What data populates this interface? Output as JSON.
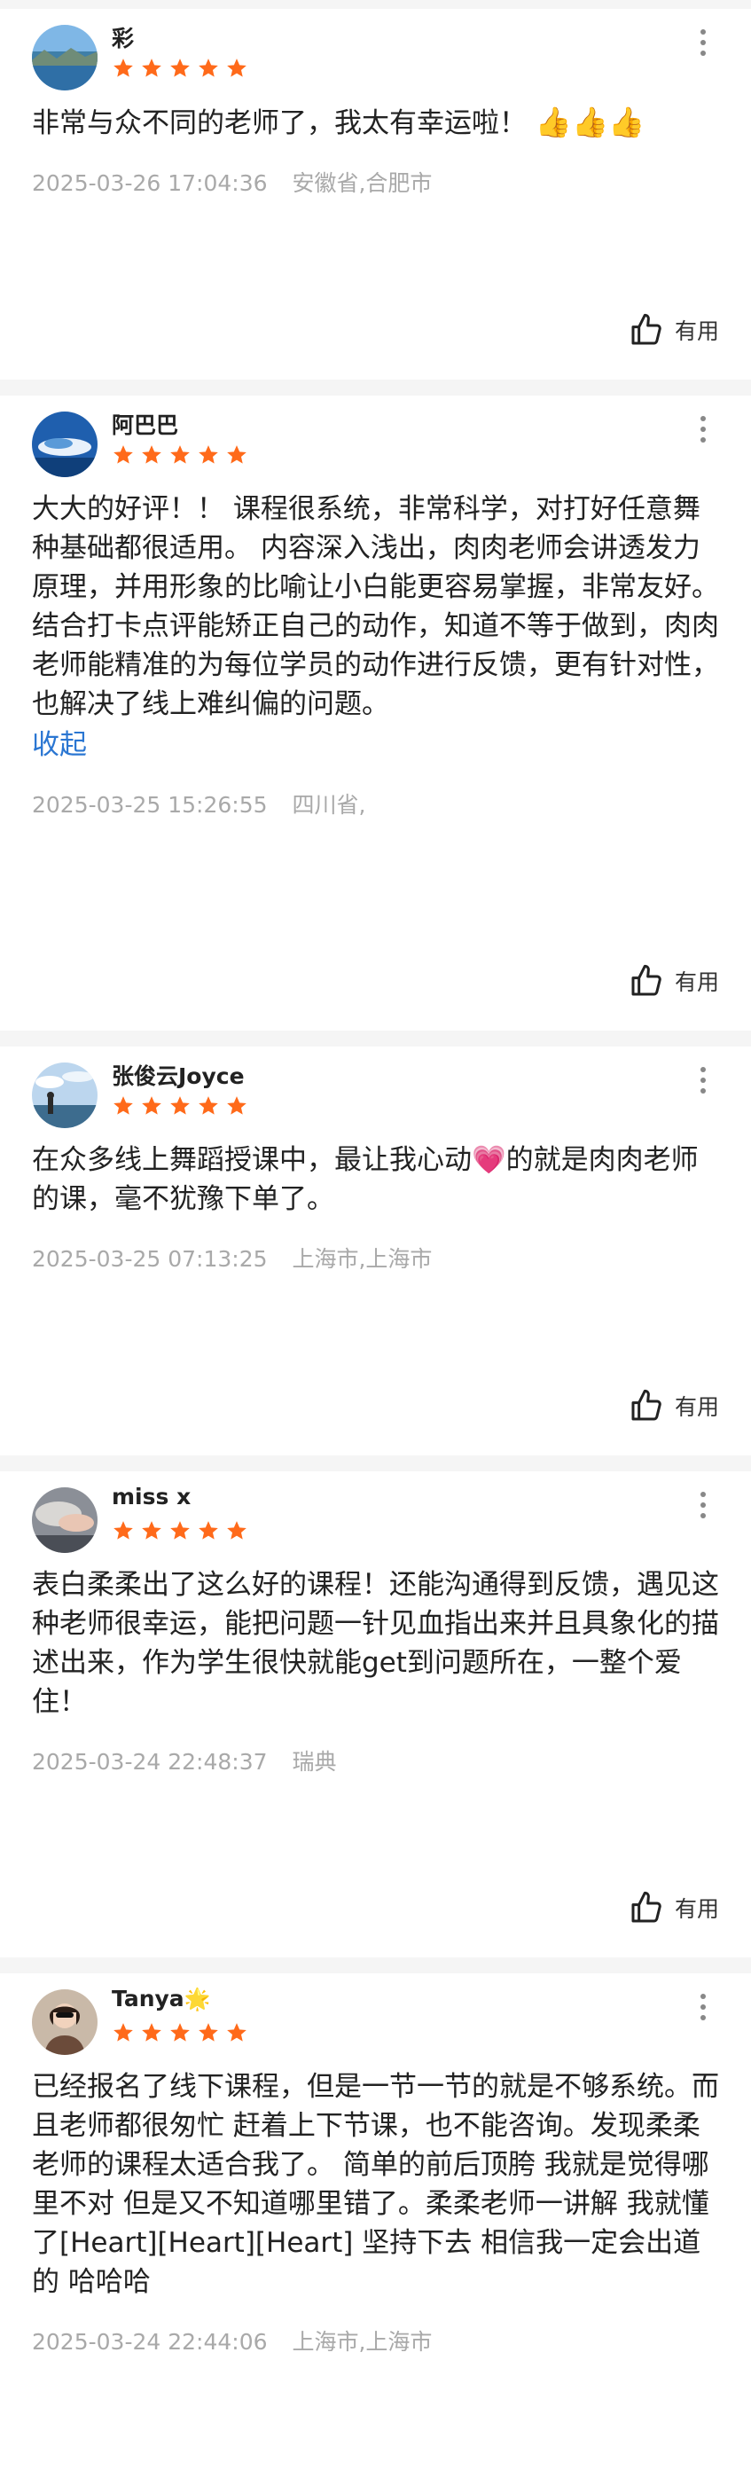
{
  "reviews": [
    {
      "name": "彩",
      "name_suffix": "",
      "rating": 5,
      "text": "非常与众不同的老师了，我太有幸运啦！",
      "text_emoji": "👍👍👍",
      "collapse": "",
      "date": "2025-03-26 17:04:36",
      "location": "安徽省,合肥市",
      "useful_label": "有用",
      "avatar": "avatar-lake-icon"
    },
    {
      "name": "阿巴巴",
      "name_suffix": "",
      "rating": 5,
      "text": "大大的好评！！ 课程很系统，非常科学，对打好任意舞种基础都很适用。 内容深入浅出，肉肉老师会讲透发力原理，并用形象的比喻让小白能更容易掌握，非常友好。 结合打卡点评能矫正自己的动作，知道不等于做到，肉肉老师能精准的为每位学员的动作进行反馈，更有针对性，也解决了线上难纠偏的问题。",
      "text_emoji": "",
      "collapse": "收起",
      "date": "2025-03-25 15:26:55",
      "location": "四川省,",
      "useful_label": "有用",
      "avatar": "avatar-wave-icon"
    },
    {
      "name": "张俊云Joyce",
      "name_suffix": "",
      "rating": 5,
      "text": "在众多线上舞蹈授课中，最让我心动💗的就是肉肉老师的课，毫不犹豫下单了。",
      "text_emoji": "",
      "collapse": "",
      "date": "2025-03-25 07:13:25",
      "location": "上海市,上海市",
      "useful_label": "有用",
      "avatar": "avatar-sky-icon"
    },
    {
      "name": "miss x",
      "name_suffix": "",
      "rating": 5,
      "text": "表白柔柔出了这么好的课程！还能沟通得到反馈，遇见这种老师很幸运，能把问题一针见血指出来并且具象化的描述出来，作为学生很快就能get到问题所在，一整个爱住！",
      "text_emoji": "",
      "collapse": "",
      "date": "2025-03-24 22:48:37",
      "location": "瑞典",
      "useful_label": "有用",
      "avatar": "avatar-cloud-icon"
    },
    {
      "name": "Tanya",
      "name_suffix": "🌟",
      "rating": 5,
      "text": "已经报名了线下课程，但是一节一节的就是不够系统。而且老师都很匆忙 赶着上下节课，也不能咨询。发现柔柔老师的课程太适合我了。 简单的前后顶胯 我就是觉得哪里不对 但是又不知道哪里错了。柔柔老师一讲解 我就懂了[Heart][Heart][Heart] 坚持下去 相信我一定会出道的 哈哈哈",
      "text_emoji": "",
      "collapse": "",
      "date": "2025-03-24 22:44:06",
      "location": "上海市,上海市",
      "useful_label": "",
      "avatar": "avatar-person-icon"
    }
  ],
  "colors": {
    "star": "#ff6a1a",
    "link": "#2a76d2",
    "meta": "#a9a9a9"
  }
}
